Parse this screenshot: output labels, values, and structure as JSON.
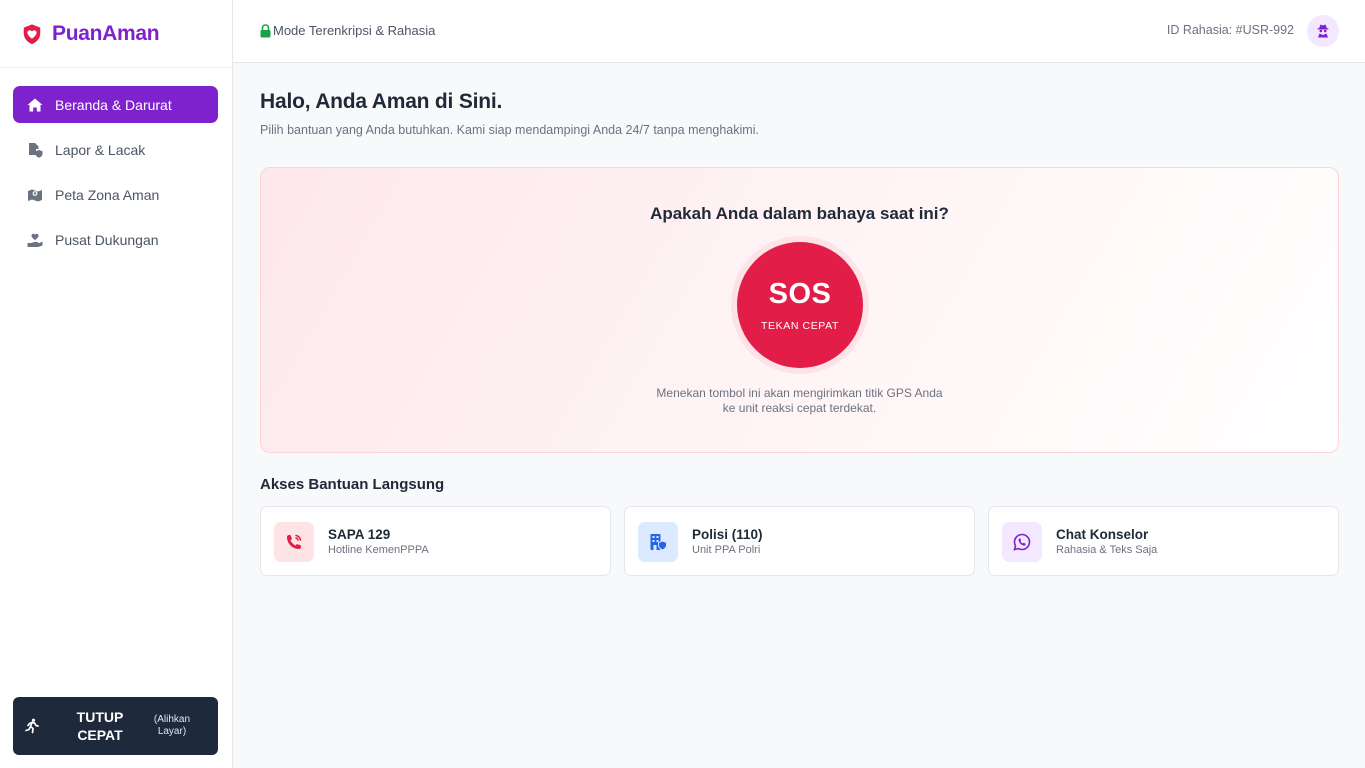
{
  "brand": {
    "name": "PuanAman",
    "logo_icon": "heart-shield-icon",
    "color": "#7e22ce"
  },
  "sidebar": {
    "items": [
      {
        "label": "Beranda & Darurat",
        "icon": "home-icon",
        "active": true
      },
      {
        "label": "Lapor & Lacak",
        "icon": "file-shield-icon",
        "active": false
      },
      {
        "label": "Peta Zona Aman",
        "icon": "map-icon",
        "active": false
      },
      {
        "label": "Pusat Dukungan",
        "icon": "hand-holding-heart-icon",
        "active": false
      }
    ],
    "quick_exit": {
      "label": "TUTUP CEPAT",
      "sublabel": "(Alihkan Layar)",
      "icon": "running-person-icon"
    }
  },
  "header": {
    "encryption_label": "Mode Terenkripsi & Rahasia",
    "encryption_icon": "lock-icon",
    "user_id": "ID Rahasia: #USR-992",
    "avatar_icon": "user-secret-icon"
  },
  "main": {
    "greeting": "Halo, Anda Aman di Sini.",
    "subtitle": "Pilih bantuan yang Anda butuhkan. Kami siap mendampingi Anda 24/7 tanpa menghakimi.",
    "sos": {
      "question": "Apakah Anda dalam bahaya saat ini?",
      "button_label": "SOS",
      "button_sublabel": "TEKAN CEPAT",
      "note_line1": "Menekan tombol ini akan mengirimkan titik GPS Anda",
      "note_line2": "ke unit reaksi cepat terdekat.",
      "color": "#e11d48"
    },
    "direct_help": {
      "title": "Akses Bantuan Langsung",
      "cards": [
        {
          "title": "SAPA 129",
          "subtitle": "Hotline KemenPPPA",
          "icon": "phone-volume-icon",
          "icon_color": "#e11d48",
          "bg": "#ffe4e6"
        },
        {
          "title": "Polisi (110)",
          "subtitle": "Unit PPA Polri",
          "icon": "building-shield-icon",
          "icon_color": "#2563eb",
          "bg": "#dbeafe"
        },
        {
          "title": "Chat Konselor",
          "subtitle": "Rahasia & Teks Saja",
          "icon": "whatsapp-icon",
          "icon_color": "#7e22ce",
          "bg": "#f3e8ff"
        }
      ]
    }
  }
}
